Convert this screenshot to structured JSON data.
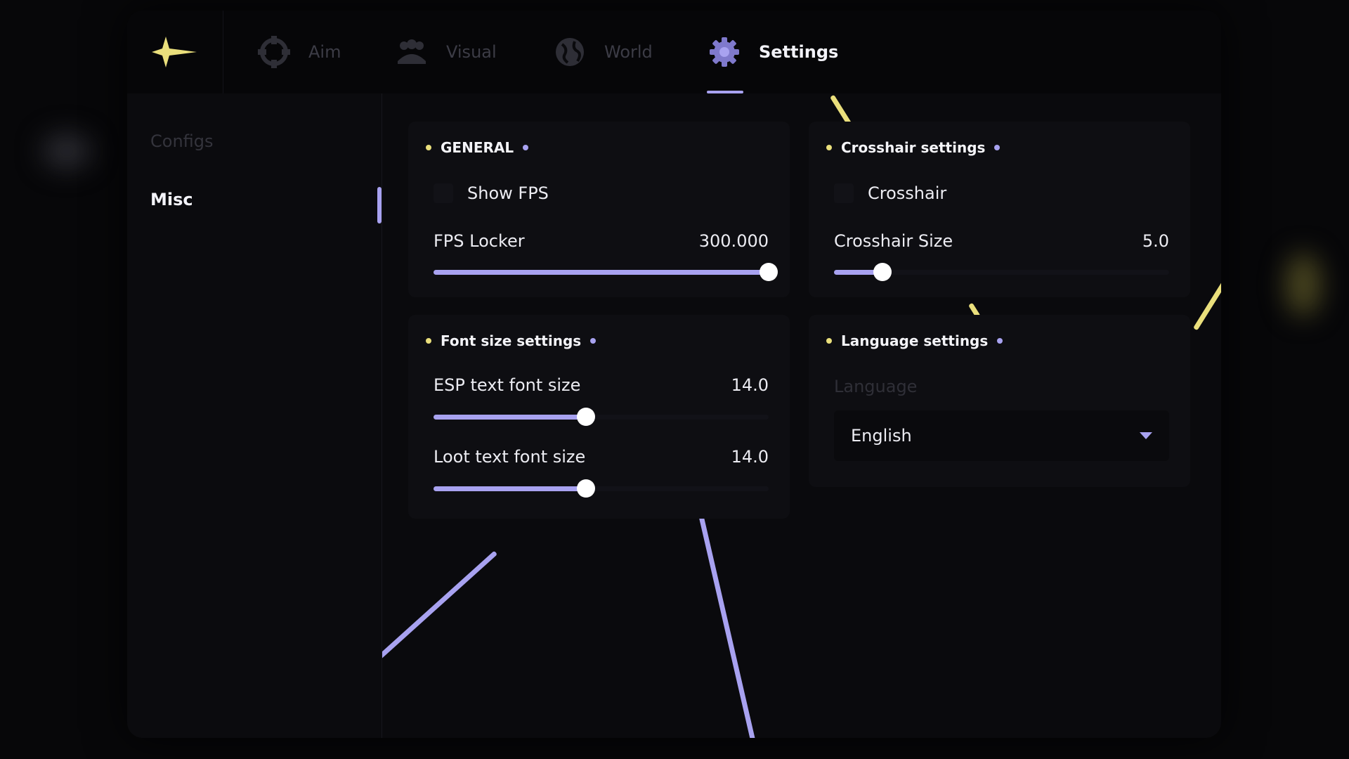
{
  "tabs": [
    {
      "label": "Aim",
      "icon": "crosshair-icon",
      "active": false
    },
    {
      "label": "Visual",
      "icon": "users-icon",
      "active": false
    },
    {
      "label": "World",
      "icon": "globe-icon",
      "active": false
    },
    {
      "label": "Settings",
      "icon": "gear-icon",
      "active": true
    }
  ],
  "sidebar": {
    "items": [
      {
        "label": "Configs",
        "active": false
      },
      {
        "label": "Misc",
        "active": true
      }
    ]
  },
  "panels": {
    "general": {
      "title": "GENERAL",
      "show_fps": {
        "label": "Show FPS",
        "checked": false
      },
      "fps_locker": {
        "label": "FPS Locker",
        "value": "300.000",
        "fraction": 1.0
      }
    },
    "crosshair": {
      "title": "Crosshair settings",
      "crosshair": {
        "label": "Crosshair",
        "checked": false
      },
      "crosshair_size": {
        "label": "Crosshair Size",
        "value": "5.0",
        "fraction": 0.145
      }
    },
    "font_size": {
      "title": "Font size settings",
      "esp_font": {
        "label": "ESP text font size",
        "value": "14.0",
        "fraction": 0.455
      },
      "loot_font": {
        "label": "Loot text font size",
        "value": "14.0",
        "fraction": 0.455
      }
    },
    "language": {
      "title": "Language settings",
      "field_label": "Language",
      "selected": "English"
    }
  },
  "colors": {
    "accent": "#a8a2f0",
    "highlight": "#eadf7c",
    "background": "#0a0a0d",
    "panel": "#0e0e12"
  }
}
